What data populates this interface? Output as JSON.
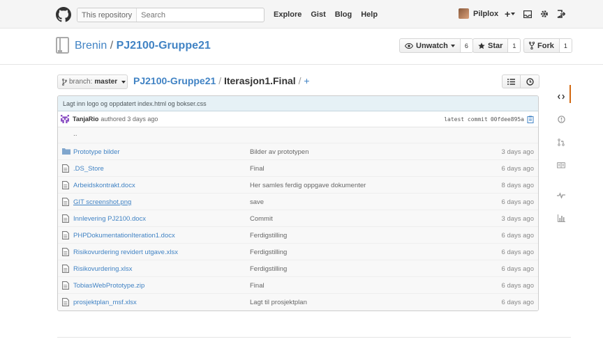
{
  "header": {
    "search_scope": "This repository",
    "search_placeholder": "Search",
    "nav": [
      "Explore",
      "Gist",
      "Blog",
      "Help"
    ],
    "username": "Pilplox",
    "plus_label": "+"
  },
  "repo": {
    "owner": "Brenin",
    "separator": "/",
    "name": "PJ2100-Gruppe21",
    "unwatch_label": "Unwatch",
    "watch_count": "6",
    "star_label": "Star",
    "star_count": "1",
    "fork_label": "Fork",
    "fork_count": "1"
  },
  "branch": {
    "prefix": "branch:",
    "name": "master"
  },
  "breadcrumb": {
    "root": "PJ2100-Gruppe21",
    "slash1": "/",
    "current": "Iterasjon1.Final",
    "slash2": "/",
    "add": "+"
  },
  "commit": {
    "message": "Lagt inn logo og oppdatert index.html og bokser.css",
    "author": "TanjaRio",
    "authored": "authored 3 days ago",
    "latest_label": "latest commit",
    "sha": "00fdee895a"
  },
  "files": {
    "parent": "..",
    "rows": [
      {
        "name": "Prototype bilder",
        "message": "Bilder av prototypen",
        "age": "3 days ago",
        "type": "folder"
      },
      {
        "name": ".DS_Store",
        "message": "Final",
        "age": "6 days ago",
        "type": "file"
      },
      {
        "name": "Arbeidskontrakt.docx",
        "message": "Her samles ferdig oppgave dokumenter",
        "age": "8 days ago",
        "type": "file"
      },
      {
        "name": "GIT screenshot.png",
        "message": "save",
        "age": "6 days ago",
        "type": "file"
      },
      {
        "name": "Innlevering PJ2100.docx",
        "message": "Commit",
        "age": "3 days ago",
        "type": "file"
      },
      {
        "name": "PHPDokumentationIteration1.docx",
        "message": "Ferdigstilling",
        "age": "6 days ago",
        "type": "file"
      },
      {
        "name": "Risikovurdering revidert utgave.xlsx",
        "message": "Ferdigstilling",
        "age": "6 days ago",
        "type": "file"
      },
      {
        "name": "Risikovurdering.xlsx",
        "message": "Ferdigstilling",
        "age": "6 days ago",
        "type": "file"
      },
      {
        "name": "TobiasWebPrototype.zip",
        "message": "Final",
        "age": "6 days ago",
        "type": "file"
      },
      {
        "name": "prosjektplan_msf.xlsx",
        "message": "Lagt til prosjektplan",
        "age": "6 days ago",
        "type": "file"
      }
    ]
  },
  "colors": {
    "link": "#4183c4",
    "commit_bg": "#e6f1f6",
    "active_tab": "#d26911"
  }
}
